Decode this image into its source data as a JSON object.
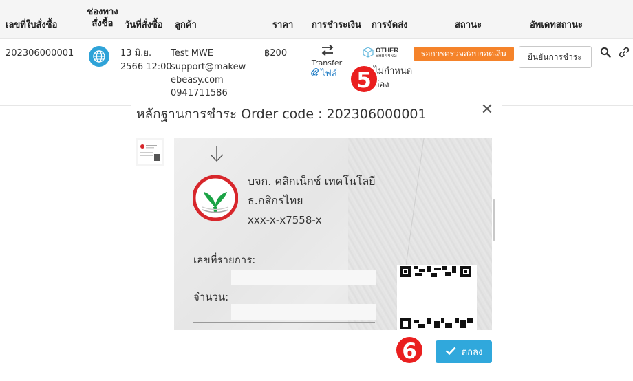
{
  "table": {
    "headers": {
      "order_no": "เลขที่ใบสั่งซื้อ",
      "channel": "ช่องทาง\nสั่งซื้อ",
      "order_date": "วันที่สั่งซื้อ",
      "customer": "ลูกค้า",
      "price": "ราคา",
      "payment": "การชำระเงิน",
      "shipping": "การจัดส่ง",
      "status": "สถานะ",
      "update_status": "อัพเดทสถานะ"
    },
    "row": {
      "order_no": "202306000001",
      "order_date_line1": "13 มิ.ย.",
      "order_date_line2": "2566 12:00",
      "customer_name": "Test MWE",
      "customer_email_line1": "support@makew",
      "customer_email_line2": "ebeasy.com",
      "customer_phone": "0941711586",
      "price": "฿200",
      "payment_method": "Transfer",
      "payment_file": "ไฟล์",
      "shipping_logo_line1": "OTHER",
      "shipping_logo_line2": "SHIPPING",
      "shipping_status_line1": "ไม่กำหนด",
      "shipping_status_line2": "ต้อง",
      "status_badge": "รอการตรวจสอบยอดเงิน",
      "confirm_button": "ยืนยันการชำระ"
    }
  },
  "steps": {
    "step5": "5",
    "step6": "6"
  },
  "modal": {
    "title": "หลักฐานการชำระ Order code : 202306000001",
    "close_symbol": "✕",
    "slip": {
      "bank_company": "บจก. คลิกเน็กซ์ เทคโนโลยี",
      "bank_name": "ธ.กสิกรไทย",
      "account_no": "xxx-x-x7558-x",
      "ref_label": "เลขที่รายการ:",
      "amount_label": "จำนวน:"
    },
    "ok_button": "ตกลง"
  },
  "colors": {
    "status_badge": "#f5832a",
    "ok_button": "#30a8dc",
    "step_badge": "#ea1f1f",
    "payment_file_link": "#1e7bc4",
    "kbank_green": "#1ba345",
    "kbank_red": "#d7262b"
  },
  "icons": {
    "channel": "globe-icon",
    "payment": "transfer-arrows-icon",
    "payment_file": "paperclip-icon",
    "shipping": "box-icon",
    "search": "search-icon",
    "link": "link-icon",
    "close": "close-icon",
    "ok": "checkmark-icon"
  }
}
